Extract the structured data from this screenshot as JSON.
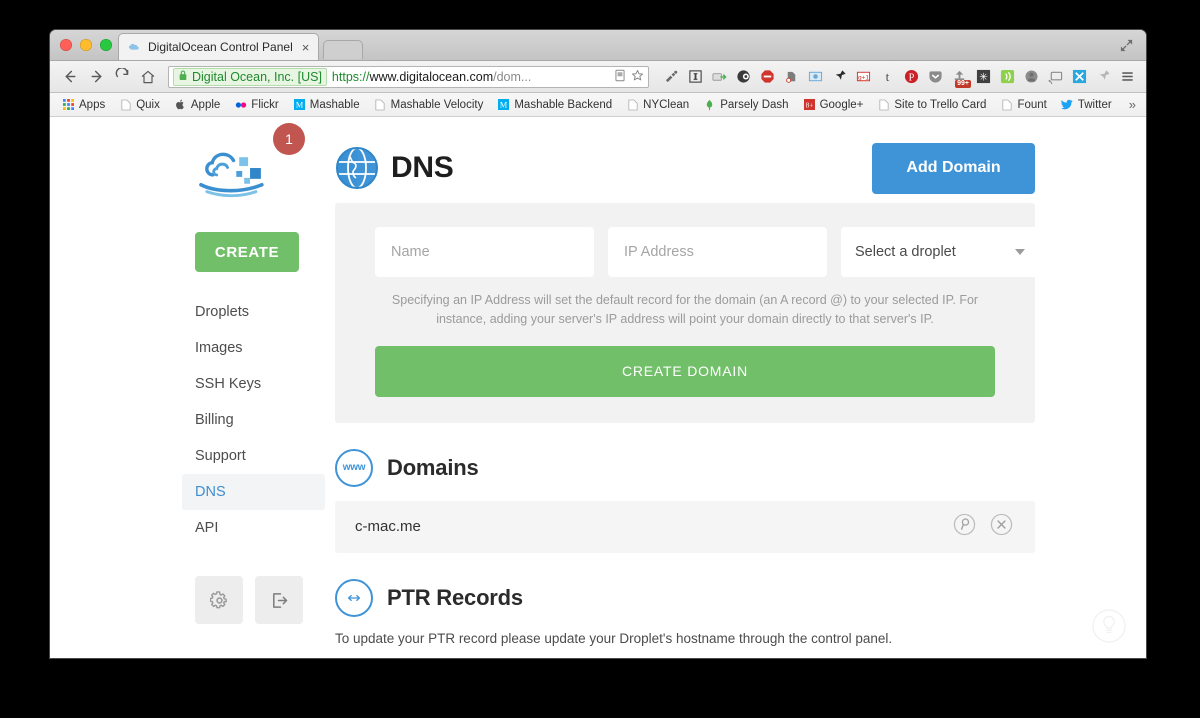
{
  "browser": {
    "tab": {
      "title": "DigitalOcean Control Panel",
      "favicon": "cloud-icon",
      "close": "×"
    },
    "nav": {
      "back": "←",
      "forward": "→",
      "reload": "C",
      "home": "home-icon"
    },
    "omnibox": {
      "lock": "lock-icon",
      "ev_label": "Digital Ocean, Inc. [US]",
      "scheme": "https://",
      "host": "www.digitalocean.com",
      "path": "/dom...",
      "reader_icon": "reader-mode-icon",
      "star_icon": "bookmark-star-icon"
    },
    "extensions": [
      {
        "name": "flashlight-icon",
        "glyph": "🔦"
      },
      {
        "name": "instapaper-icon",
        "glyph": "I"
      },
      {
        "name": "send-to-icon",
        "glyph": "➥"
      },
      {
        "name": "ghostery-icon",
        "glyph": "◖"
      },
      {
        "name": "adblock-icon",
        "glyph": "⬣"
      },
      {
        "name": "evernote-icon",
        "glyph": "◔"
      },
      {
        "name": "screenshot-icon",
        "glyph": "▣"
      },
      {
        "name": "pin-black-icon",
        "glyph": "✦"
      },
      {
        "name": "google-plus-icon",
        "glyph": "g+1"
      },
      {
        "name": "tumblr-icon",
        "glyph": "t"
      },
      {
        "name": "pinterest-icon",
        "glyph": "P"
      },
      {
        "name": "pocket-icon",
        "glyph": "▼"
      },
      {
        "name": "mailbox-icon",
        "glyph": "▲",
        "count": "99+"
      },
      {
        "name": "asterisk-icon",
        "glyph": "✱"
      },
      {
        "name": "signal-icon",
        "glyph": "≈"
      },
      {
        "name": "user-icon",
        "glyph": "●"
      },
      {
        "name": "cast-icon",
        "glyph": "▭"
      },
      {
        "name": "xmarks-icon",
        "glyph": "X"
      },
      {
        "name": "pin-grey-icon",
        "glyph": "✦"
      },
      {
        "name": "chrome-menu-icon",
        "glyph": "≡"
      }
    ],
    "bookmarks": [
      {
        "label": "Apps",
        "icon": "apps-grid-icon"
      },
      {
        "label": "Quix",
        "icon": "page-icon"
      },
      {
        "label": "Apple",
        "icon": "apple-icon"
      },
      {
        "label": "Flickr",
        "icon": "flickr-dots-icon"
      },
      {
        "label": "Mashable",
        "icon": "mashable-m-icon"
      },
      {
        "label": "Mashable Velocity",
        "icon": "page-icon"
      },
      {
        "label": "Mashable Backend",
        "icon": "mashable-m-icon"
      },
      {
        "label": "NYClean",
        "icon": "page-icon"
      },
      {
        "label": "Parsely Dash",
        "icon": "parsely-icon"
      },
      {
        "label": "Google+",
        "icon": "google-plus-icon"
      },
      {
        "label": "Site to Trello Card",
        "icon": "page-icon"
      },
      {
        "label": "Fount",
        "icon": "page-icon"
      },
      {
        "label": "Twitter",
        "icon": "twitter-bird-icon"
      }
    ],
    "bookmarks_overflow": "»",
    "maximize_icon": "fullscreen-icon"
  },
  "app": {
    "logo": {
      "name": "digitalocean-logo",
      "badge_count": "1",
      "badge_color": "#c0564f"
    },
    "sidebar": {
      "create_label": "CREATE",
      "items": [
        {
          "label": "Droplets",
          "active": false
        },
        {
          "label": "Images",
          "active": false
        },
        {
          "label": "SSH Keys",
          "active": false
        },
        {
          "label": "Billing",
          "active": false
        },
        {
          "label": "Support",
          "active": false
        },
        {
          "label": "DNS",
          "active": true
        },
        {
          "label": "API",
          "active": false
        }
      ],
      "settings_icon": "gear-icon",
      "logout_icon": "logout-icon"
    },
    "header": {
      "icon": "globe-icon",
      "title": "DNS",
      "add_domain_label": "Add Domain"
    },
    "form": {
      "name_placeholder": "Name",
      "name_value": "",
      "ip_placeholder": "IP Address",
      "ip_value": "",
      "droplet_select_value": "Select a droplet",
      "hint": "Specifying an IP Address will set the default record for the domain (an A record @) to your selected IP. For instance, adding your server's IP address will point your domain directly to that server's IP.",
      "submit_label": "CREATE DOMAIN"
    },
    "domains": {
      "icon_text": "www",
      "title": "Domains",
      "rows": [
        {
          "name": "c-mac.me",
          "search_icon": "magnifier-icon",
          "delete_icon": "remove-circle-icon"
        }
      ]
    },
    "ptr": {
      "icon": "arrows-icon",
      "title": "PTR Records",
      "text": "To update your PTR record please update your Droplet's hostname through the control panel."
    },
    "help_icon": "lightbulb-icon",
    "colors": {
      "accent_blue": "#3f94d8",
      "accent_green": "#72bf6a",
      "badge_red": "#c0564f",
      "card_bg": "#f2f2f2"
    }
  }
}
